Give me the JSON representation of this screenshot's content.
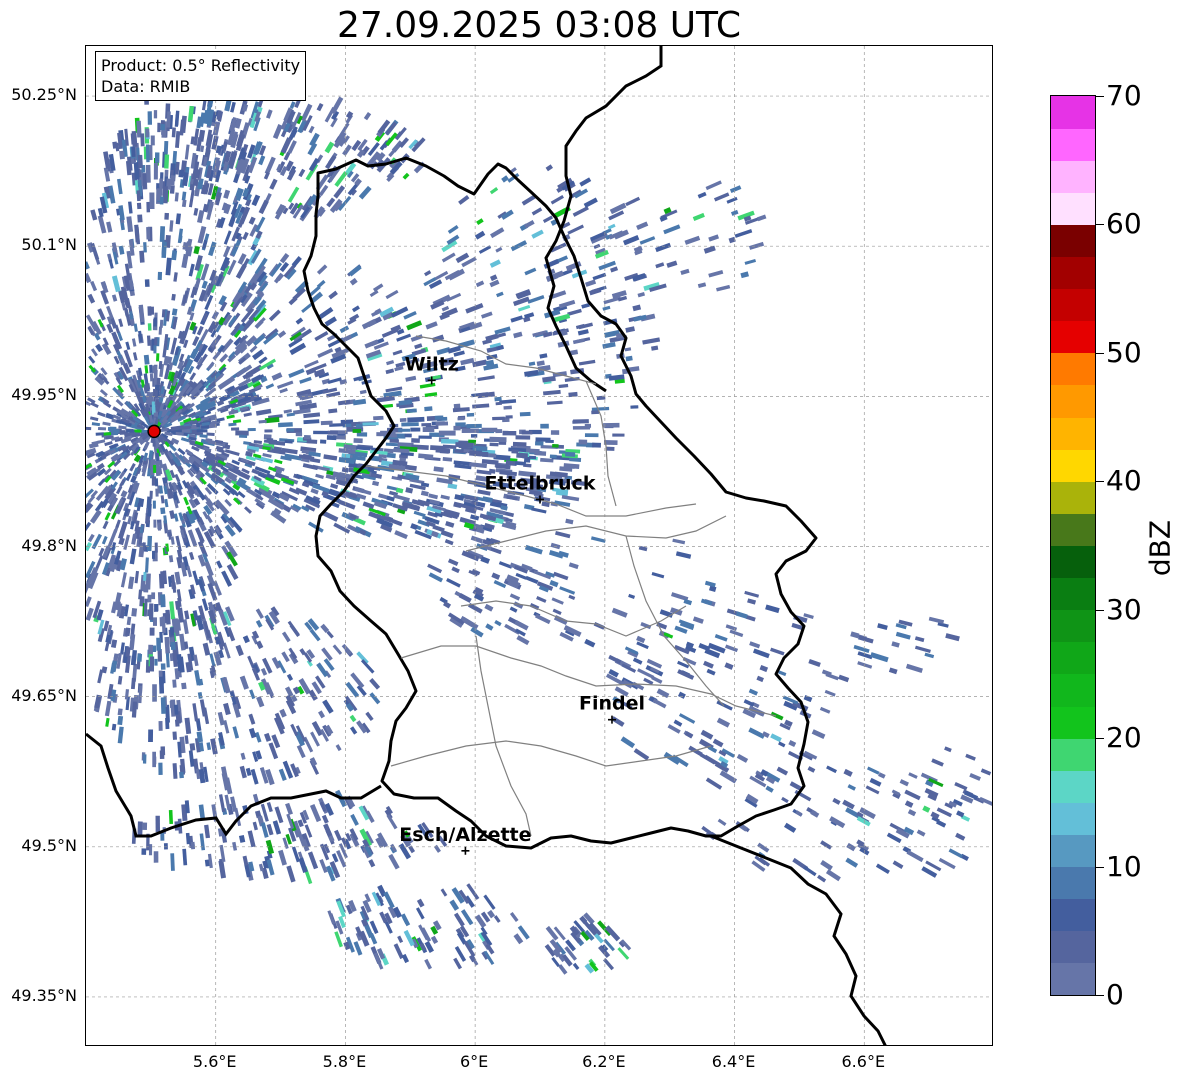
{
  "title": "27.09.2025 03:08 UTC",
  "info_box": {
    "product": "Product: 0.5° Reflectivity",
    "data": "Data: RMIB"
  },
  "map": {
    "lon_range": [
      5.4,
      6.8
    ],
    "lat_range": [
      49.3,
      50.3
    ],
    "lat_ticks": [
      {
        "value": 50.25,
        "label": "50.25°N"
      },
      {
        "value": 50.1,
        "label": "50.1°N"
      },
      {
        "value": 49.95,
        "label": "49.95°N"
      },
      {
        "value": 49.8,
        "label": "49.8°N"
      },
      {
        "value": 49.65,
        "label": "49.65°N"
      },
      {
        "value": 49.5,
        "label": "49.5°N"
      },
      {
        "value": 49.35,
        "label": "49.35°N"
      }
    ],
    "lon_ticks": [
      {
        "value": 5.6,
        "label": "5.6°E"
      },
      {
        "value": 5.8,
        "label": "5.8°E"
      },
      {
        "value": 6.0,
        "label": "6°E"
      },
      {
        "value": 6.2,
        "label": "6.2°E"
      },
      {
        "value": 6.4,
        "label": "6.4°E"
      },
      {
        "value": 6.6,
        "label": "6.6°E"
      }
    ],
    "radar_site": {
      "lon": 5.505,
      "lat": 49.915
    },
    "cities": [
      {
        "name": "Wiltz",
        "lon": 5.933,
        "lat": 49.966
      },
      {
        "name": "Ettelbruck",
        "lon": 6.1,
        "lat": 49.847
      },
      {
        "name": "Findel",
        "lon": 6.211,
        "lat": 49.627
      },
      {
        "name": "Esch/Alzette",
        "lon": 5.985,
        "lat": 49.496
      }
    ]
  },
  "colorbar": {
    "label": "dBZ",
    "min": 0,
    "max": 70,
    "ticks": [
      0,
      10,
      20,
      30,
      40,
      50,
      60,
      70
    ],
    "colors": [
      "#6675a8",
      "#55659e",
      "#435e9e",
      "#4a79ad",
      "#5799c1",
      "#63bfd8",
      "#5cd6c6",
      "#3fd671",
      "#12c41c",
      "#11b71c",
      "#10a718",
      "#0f9416",
      "#0a7e12",
      "#06600c",
      "#48781a",
      "#aab30a",
      "#ffd700",
      "#ffb400",
      "#ff9900",
      "#ff7a00",
      "#e50000",
      "#c40000",
      "#a20000",
      "#7a0000",
      "#ffe0ff",
      "#ffb3ff",
      "#ff66ff",
      "#e633e6"
    ]
  }
}
